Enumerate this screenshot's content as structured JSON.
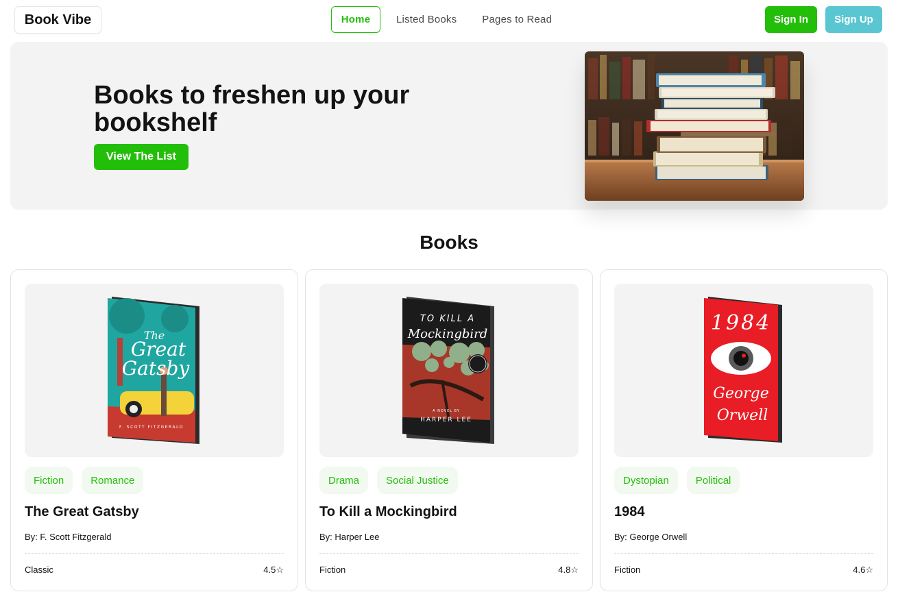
{
  "nav": {
    "logo": "Book Vibe",
    "items": [
      {
        "label": "Home",
        "active": true
      },
      {
        "label": "Listed Books",
        "active": false
      },
      {
        "label": "Pages to Read",
        "active": false
      }
    ],
    "sign_in": "Sign In",
    "sign_up": "Sign Up"
  },
  "hero": {
    "title": "Books to freshen up your bookshelf",
    "button": "View The List"
  },
  "section": {
    "title": "Books"
  },
  "books": [
    {
      "tags": [
        "Fiction",
        "Romance"
      ],
      "title": "The Great Gatsby",
      "author": "By: F. Scott Fitzgerald",
      "category": "Classic",
      "rating": "4.5",
      "star": "☆",
      "cover": {
        "title_line1": "The",
        "title_line2": "Great",
        "title_line3": "Gatsby",
        "author": "F. SCOTT FITZGERALD"
      }
    },
    {
      "tags": [
        "Drama",
        "Social Justice"
      ],
      "title": "To Kill a Mockingbird",
      "author": "By: Harper Lee",
      "category": "Fiction",
      "rating": "4.8",
      "star": "☆",
      "cover": {
        "title_line1": "TO KILL A",
        "title_line2": "Mockingbird",
        "subtitle": "A NOVEL BY",
        "author": "HARPER LEE"
      }
    },
    {
      "tags": [
        "Dystopian",
        "Political"
      ],
      "title": "1984",
      "author": "By: George Orwell",
      "category": "Fiction",
      "rating": "4.6",
      "star": "☆",
      "cover": {
        "title_line1": "1984",
        "author_line1": "George",
        "author_line2": "Orwell"
      }
    }
  ],
  "colors": {
    "accent": "#23be0a",
    "signup": "#59c6d2",
    "tag_bg": "#f2f9f0",
    "hero_bg": "#f3f3f3"
  }
}
